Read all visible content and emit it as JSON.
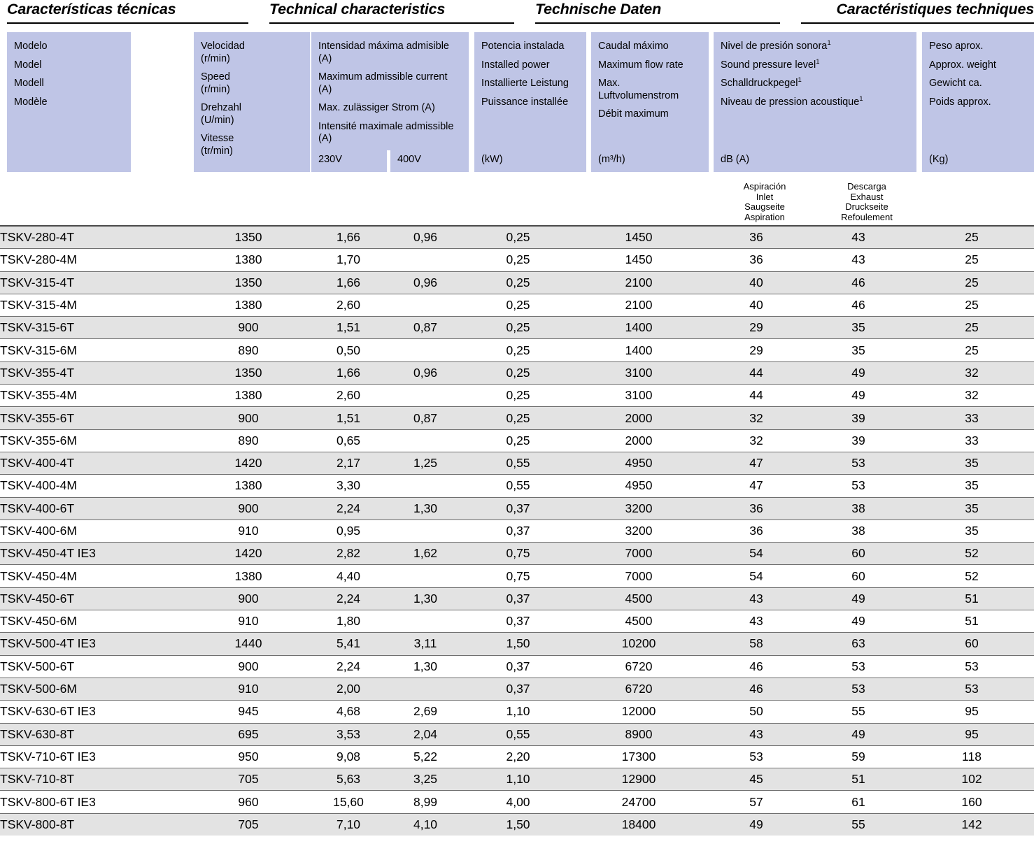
{
  "titles": [
    {
      "text": "Características técnicas",
      "align": "left"
    },
    {
      "text": "Technical characteristics",
      "align": "left"
    },
    {
      "text": "Technische Daten",
      "align": "left"
    },
    {
      "text": "Caractéristiques techniques",
      "align": "right"
    }
  ],
  "header": {
    "model": {
      "lines": [
        "Modelo",
        "Model",
        "Modell",
        "Modèle"
      ],
      "unit": ""
    },
    "speed": {
      "lines": [
        "Velocidad\n(r/min)",
        "Speed\n(r/min)",
        "Drehzahl\n(U/min)",
        "Vitesse\n(tr/min)"
      ],
      "l1a": "Velocidad",
      "l1b": "(r/min)",
      "l2a": "Speed",
      "l2b": "(r/min)",
      "l3a": "Drehzahl",
      "l3b": "(U/min)",
      "l4a": "Vitesse",
      "l4b": "(tr/min)",
      "unit": ""
    },
    "current": {
      "l1": "Intensidad máxima admisible (A)",
      "l2": "Maximum admissible current (A)",
      "l3": "Max. zulässiger Strom (A)",
      "l4": "Intensité maximale admissible (A)",
      "unit_230": "230V",
      "unit_400": "400V"
    },
    "power": {
      "l1": "Potencia instalada",
      "l2": "Installed power",
      "l3": "Installierte Leistung",
      "l4": "Puissance installée",
      "unit": "(kW)"
    },
    "flow": {
      "l1": "Caudal máximo",
      "l2": "Maximum flow rate",
      "l3": "Max. Luftvolumenstrom",
      "l4": "Débit maximum",
      "unit": "(m³/h)"
    },
    "sound": {
      "l1": "Nivel de presión sonora",
      "l2": "Sound pressure level",
      "l3": "Schalldruckpegel",
      "l4": "Niveau de pression acoustique",
      "footnote_mark": "1",
      "unit": "dB (A)"
    },
    "weight": {
      "l1": "Peso aprox.",
      "l2": "Approx. weight",
      "l3": "Gewicht ca.",
      "l4": "Poids approx.",
      "unit": "(Kg)"
    },
    "sub_inlet": {
      "l1": "Aspiración",
      "l2": "Inlet",
      "l3": "Saugseite",
      "l4": "Aspiration"
    },
    "sub_exhaust": {
      "l1": "Descarga",
      "l2": "Exhaust",
      "l3": "Druckseite",
      "l4": "Refoulement"
    }
  },
  "colors": {
    "header_block": "#bfc5e6",
    "row_shaded": "#e3e3e3",
    "row_plain": "#ffffff",
    "rule": "#6f6f6f",
    "text": "#000000"
  },
  "chart_data": {
    "type": "table",
    "title": "Características técnicas / Technical characteristics / Technische Daten / Caractéristiques techniques",
    "columns": [
      "Modelo / Model / Modell / Modèle",
      "Velocidad (r/min)",
      "Intensidad máxima admisible (A) 230V",
      "Intensidad máxima admisible (A) 400V",
      "Potencia instalada (kW)",
      "Caudal máximo (m³/h)",
      "Nivel de presión sonora dB(A) — Aspiración / Inlet",
      "Nivel de presión sonora dB(A) — Descarga / Exhaust",
      "Peso aprox. (Kg)"
    ],
    "rows": [
      [
        "TSKV-280-4T",
        "1350",
        "1,66",
        "0,96",
        "0,25",
        "1450",
        "36",
        "43",
        "25"
      ],
      [
        "TSKV-280-4M",
        "1380",
        "1,70",
        "",
        "0,25",
        "1450",
        "36",
        "43",
        "25"
      ],
      [
        "TSKV-315-4T",
        "1350",
        "1,66",
        "0,96",
        "0,25",
        "2100",
        "40",
        "46",
        "25"
      ],
      [
        "TSKV-315-4M",
        "1380",
        "2,60",
        "",
        "0,25",
        "2100",
        "40",
        "46",
        "25"
      ],
      [
        "TSKV-315-6T",
        "900",
        "1,51",
        "0,87",
        "0,25",
        "1400",
        "29",
        "35",
        "25"
      ],
      [
        "TSKV-315-6M",
        "890",
        "0,50",
        "",
        "0,25",
        "1400",
        "29",
        "35",
        "25"
      ],
      [
        "TSKV-355-4T",
        "1350",
        "1,66",
        "0,96",
        "0,25",
        "3100",
        "44",
        "49",
        "32"
      ],
      [
        "TSKV-355-4M",
        "1380",
        "2,60",
        "",
        "0,25",
        "3100",
        "44",
        "49",
        "32"
      ],
      [
        "TSKV-355-6T",
        "900",
        "1,51",
        "0,87",
        "0,25",
        "2000",
        "32",
        "39",
        "33"
      ],
      [
        "TSKV-355-6M",
        "890",
        "0,65",
        "",
        "0,25",
        "2000",
        "32",
        "39",
        "33"
      ],
      [
        "TSKV-400-4T",
        "1420",
        "2,17",
        "1,25",
        "0,55",
        "4950",
        "47",
        "53",
        "35"
      ],
      [
        "TSKV-400-4M",
        "1380",
        "3,30",
        "",
        "0,55",
        "4950",
        "47",
        "53",
        "35"
      ],
      [
        "TSKV-400-6T",
        "900",
        "2,24",
        "1,30",
        "0,37",
        "3200",
        "36",
        "38",
        "35"
      ],
      [
        "TSKV-400-6M",
        "910",
        "0,95",
        "",
        "0,37",
        "3200",
        "36",
        "38",
        "35"
      ],
      [
        "TSKV-450-4T IE3",
        "1420",
        "2,82",
        "1,62",
        "0,75",
        "7000",
        "54",
        "60",
        "52"
      ],
      [
        "TSKV-450-4M",
        "1380",
        "4,40",
        "",
        "0,75",
        "7000",
        "54",
        "60",
        "52"
      ],
      [
        "TSKV-450-6T",
        "900",
        "2,24",
        "1,30",
        "0,37",
        "4500",
        "43",
        "49",
        "51"
      ],
      [
        "TSKV-450-6M",
        "910",
        "1,80",
        "",
        "0,37",
        "4500",
        "43",
        "49",
        "51"
      ],
      [
        "TSKV-500-4T IE3",
        "1440",
        "5,41",
        "3,11",
        "1,50",
        "10200",
        "58",
        "63",
        "60"
      ],
      [
        "TSKV-500-6T",
        "900",
        "2,24",
        "1,30",
        "0,37",
        "6720",
        "46",
        "53",
        "53"
      ],
      [
        "TSKV-500-6M",
        "910",
        "2,00",
        "",
        "0,37",
        "6720",
        "46",
        "53",
        "53"
      ],
      [
        "TSKV-630-6T IE3",
        "945",
        "4,68",
        "2,69",
        "1,10",
        "12000",
        "50",
        "55",
        "95"
      ],
      [
        "TSKV-630-8T",
        "695",
        "3,53",
        "2,04",
        "0,55",
        "8900",
        "43",
        "49",
        "95"
      ],
      [
        "TSKV-710-6T IE3",
        "950",
        "9,08",
        "5,22",
        "2,20",
        "17300",
        "53",
        "59",
        "118"
      ],
      [
        "TSKV-710-8T",
        "705",
        "5,63",
        "3,25",
        "1,10",
        "12900",
        "45",
        "51",
        "102"
      ],
      [
        "TSKV-800-6T IE3",
        "960",
        "15,60",
        "8,99",
        "4,00",
        "24700",
        "57",
        "61",
        "160"
      ],
      [
        "TSKV-800-8T",
        "705",
        "7,10",
        "4,10",
        "1,50",
        "18400",
        "49",
        "55",
        "142"
      ]
    ],
    "shaded_row_indices": [
      0,
      2,
      4,
      6,
      8,
      10,
      12,
      14,
      16,
      18,
      20,
      22,
      24,
      26
    ]
  }
}
